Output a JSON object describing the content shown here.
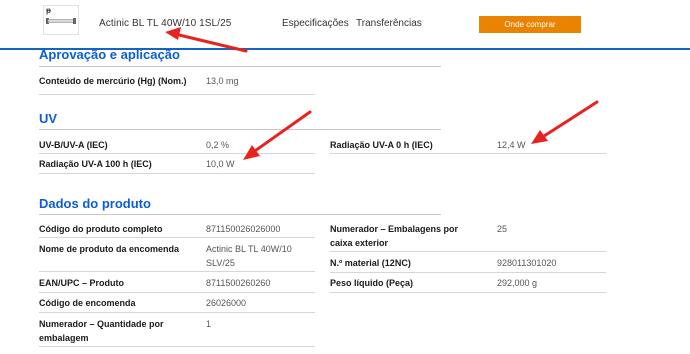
{
  "header": {
    "product_title": "Actinic BL TL 40W/10 1SL/25",
    "tabs": [
      "Especificações",
      "Transferências"
    ],
    "buy_label": "Onde comprar"
  },
  "sections": {
    "approval": {
      "title": "Aprovação e aplicação",
      "rows": [
        {
          "label": "Conteúdo de mercúrio (Hg) (Nom.)",
          "value": "13,0 mg"
        }
      ]
    },
    "uv": {
      "title": "UV",
      "rows_left": [
        {
          "label": "UV-B/UV-A (IEC)",
          "value": "0,2 %"
        },
        {
          "label": "Radiação UV-A 100 h (IEC)",
          "value": "10,0 W"
        }
      ],
      "rows_right": [
        {
          "label": "Radiação UV-A 0 h (IEC)",
          "value": "12,4 W"
        }
      ]
    },
    "product": {
      "title": "Dados do produto",
      "rows_left": [
        {
          "label": "Código do produto completo",
          "value": "871150026026000"
        },
        {
          "label": "Nome de produto da encomenda",
          "value": "Actinic BL TL 40W/10 SLV/25"
        },
        {
          "label": "EAN/UPC – Produto",
          "value": "8711500260260"
        },
        {
          "label": "Código de encomenda",
          "value": "26026000"
        },
        {
          "label": "Numerador – Quantidade por embalagem",
          "value": "1"
        }
      ],
      "rows_right": [
        {
          "label": "Numerador – Embalagens por caixa exterior",
          "value": "25"
        },
        {
          "label": "N.º material (12NC)",
          "value": "928011301020"
        },
        {
          "label": "Peso líquido (Peça)",
          "value": "292,000 g"
        }
      ]
    }
  },
  "annotation_color": "#e8231f",
  "accent": "#0b5ed7",
  "button_color": "#e98300"
}
